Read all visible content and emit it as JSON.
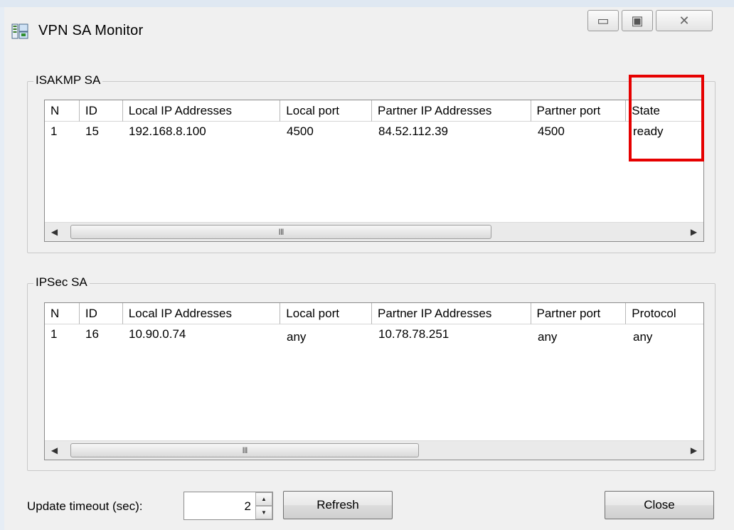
{
  "window": {
    "title": "VPN SA Monitor",
    "minimize_glyph": "▭",
    "maximize_glyph": "▣",
    "close_glyph": "✕",
    "app_icon": "monitor-app-icon"
  },
  "isakmp": {
    "group_title": "ISAKMP SA",
    "columns": [
      "N",
      "ID",
      "Local IP Addresses",
      "Local port",
      "Partner IP Addresses",
      "Partner port",
      "State"
    ],
    "rows": [
      [
        "1",
        "15",
        "192.168.8.100",
        "4500",
        "84.52.112.39",
        "4500",
        "ready"
      ]
    ],
    "scroll_thumb_text": "III"
  },
  "ipsec": {
    "group_title": "IPSec SA",
    "columns": [
      "N",
      "ID",
      "Local IP Addresses",
      "Local port",
      "Partner IP Addresses",
      "Partner port",
      "Protocol"
    ],
    "rows": [
      [
        "1",
        "16",
        "10.90.0.74",
        "any",
        "10.78.78.251",
        "any",
        "any"
      ]
    ],
    "scroll_thumb_text": "III"
  },
  "controls": {
    "update_timeout_label": "Update timeout (sec):",
    "update_timeout_value": "2",
    "refresh_label": "Refresh",
    "close_label": "Close"
  },
  "colors": {
    "highlight": "#e60000",
    "background": "#f0f0f0"
  }
}
